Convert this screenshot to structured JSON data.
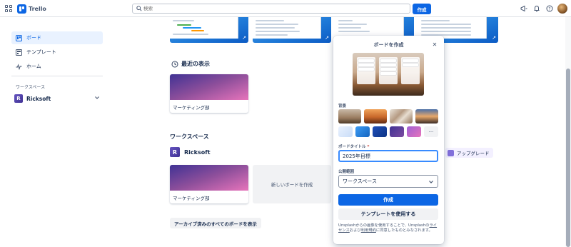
{
  "topbar": {
    "app_name": "Trello",
    "search_placeholder": "検索",
    "create_label": "作成"
  },
  "sidebar": {
    "items": [
      {
        "label": "ボード",
        "active": true
      },
      {
        "label": "テンプレート",
        "active": false
      },
      {
        "label": "ホーム",
        "active": false
      }
    ],
    "workspaces_label": "ワークスペース",
    "workspace": {
      "initial": "R",
      "name": "Ricksoft"
    }
  },
  "main": {
    "recent_title": "最近の表示",
    "recent_boards": [
      {
        "name": "マーケティング部"
      }
    ],
    "workspaces_title": "ワークスペース",
    "workspace": {
      "initial": "R",
      "name": "Ricksoft"
    },
    "workspace_boards": [
      {
        "name": "マーケティング部"
      }
    ],
    "new_board_label": "新しいボードを作成",
    "archive_label": "アーカイブ済みのすべてのボードを表示",
    "upgrade_label": "アップグレード"
  },
  "popover": {
    "title": "ボードを作成",
    "background_label": "背景",
    "title_label": "ボードタイトル",
    "required_mark": "*",
    "title_value": "2025年目標",
    "visibility_label": "公開範囲",
    "visibility_value": "ワークスペース",
    "create_button": "作成",
    "template_button": "テンプレートを使用する",
    "legal_before": "Unsplashからの画像を使用することで、Unsplashの",
    "legal_link1": "ライセンス",
    "legal_mid": "および",
    "legal_link2": "利用規約",
    "legal_after": "に同意したものとみなされます。",
    "more_label": "···"
  },
  "colors": {
    "primary": "#0c66e4",
    "board_gradient": [
      "#403294",
      "#e774bb"
    ]
  }
}
